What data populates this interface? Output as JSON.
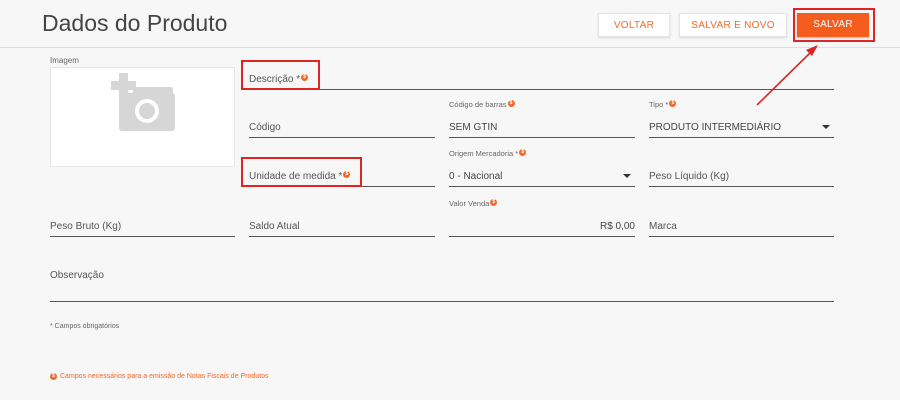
{
  "header": {
    "title": "Dados do Produto",
    "buttons": {
      "back": "VOLTAR",
      "save_new": "SALVAR E NOVO",
      "save": "SALVAR"
    }
  },
  "image": {
    "label": "Imagem"
  },
  "fields": {
    "descricao": {
      "label": "Descrição *"
    },
    "codigo": {
      "label": "Código"
    },
    "codigo_barras": {
      "label": "Código de barras",
      "value": "SEM GTIN"
    },
    "tipo": {
      "label": "Tipo *",
      "value": "PRODUTO INTERMEDIÁRIO"
    },
    "unidade": {
      "label": "Unidade de medida *"
    },
    "origem": {
      "label": "Origem Mercadoria *",
      "value": "0 - Nacional"
    },
    "peso_liquido": {
      "label": "Peso Líquido (Kg)"
    },
    "peso_bruto": {
      "label": "Peso Bruto (Kg)"
    },
    "saldo": {
      "label": "Saldo Atual"
    },
    "valor_venda": {
      "label": "Valor Venda",
      "value": "R$ 0,00"
    },
    "marca": {
      "label": "Marca"
    },
    "observacao": {
      "label": "Observação"
    }
  },
  "footnotes": {
    "required": "* Campos obrigatórios",
    "fiscal": "Campos necessários para a emissão de Notas Fiscais de Produtos"
  },
  "colors": {
    "accent": "#f06a2a",
    "primary_button": "#f45d1e",
    "annotation": "#e02424"
  }
}
